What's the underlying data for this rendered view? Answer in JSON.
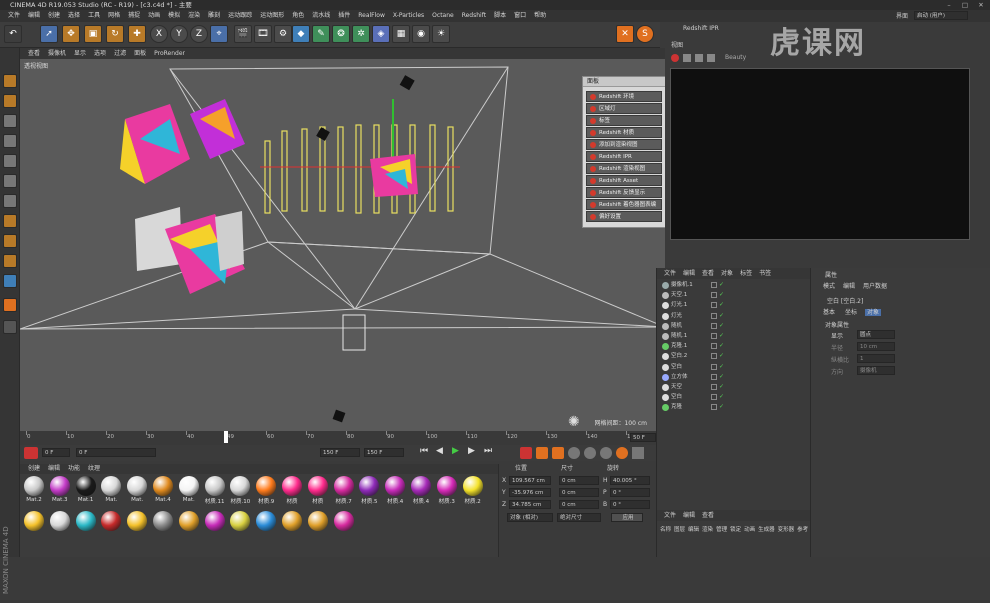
{
  "window": {
    "title": "CINEMA 4D R19.053 Studio (RC - R19) - [c3.c4d *] - 主要",
    "layout_label": "界面",
    "layout_value": "启动 (用户)"
  },
  "menu": [
    "文件",
    "编辑",
    "创建",
    "选择",
    "工具",
    "网格",
    "捕捉",
    "动画",
    "模拟",
    "渲染",
    "雕刻",
    "运动跟踪",
    "运动图形",
    "角色",
    "流水线",
    "插件",
    "RealFlow",
    "X-Particles",
    "Octane",
    "Redshift",
    "脚本",
    "窗口",
    "帮助"
  ],
  "toolbar": {
    "axis_labels": [
      "X",
      "Y",
      "Z"
    ],
    "redshift_icon": "S"
  },
  "viewport": {
    "tabs": [
      "查看",
      "摄像机",
      "显示",
      "选项",
      "过滤",
      "面板",
      "ProRender"
    ],
    "label": "透视视图",
    "grid_spacing": "网格间距：100 cm"
  },
  "timeline": {
    "ticks": [
      "0",
      "10",
      "20",
      "30",
      "40",
      "49",
      "60",
      "70",
      "80",
      "90",
      "100",
      "110",
      "120",
      "130",
      "140",
      "150"
    ],
    "current_frame": "49",
    "end_label": "50 F"
  },
  "transport": {
    "start": "0 F",
    "field_start": "0 F",
    "field_end": "150 F",
    "field_end2": "150 F"
  },
  "redshift_menu": {
    "header": "面板",
    "items": [
      "Redshift 环境",
      "区域灯",
      "标签",
      "Redshift 材质",
      "添加到渲染视图",
      "Redshift IPR",
      "Redshift 渲染视图",
      "Redshift Asset Manager",
      "Redshift 反馈显示",
      "Redshift 着色器图表编辑器",
      "偏好设置"
    ]
  },
  "ipr": {
    "title": "Redshift IPR",
    "subtitle": "视图",
    "dropdown": "Beauty"
  },
  "watermark": "虎课网",
  "object_manager": {
    "tabs": [
      "文件",
      "编辑",
      "查看",
      "对象",
      "标签",
      "书签"
    ],
    "rows": [
      "摄像机.1",
      "天空.1",
      "灯光.1",
      "灯光",
      "随机",
      "随机.1",
      "克隆.1",
      "空白.2",
      "空白",
      "立方体",
      "天空",
      "空白",
      "克隆"
    ],
    "bottom_tabs": [
      "文件",
      "编辑",
      "查看"
    ],
    "footer": [
      "名称",
      "图层",
      "编辑",
      "渲染",
      "管理",
      "锁定",
      "动画",
      "生成器",
      "变形器",
      "参考"
    ]
  },
  "attributes": {
    "header": "属性",
    "tabs": [
      "模式",
      "编辑",
      "用户数据"
    ],
    "object_name": "空白 [空白.2]",
    "subtabs": [
      "基本",
      "坐标",
      "对象"
    ],
    "section": "对象属性",
    "display_label": "显示",
    "display_value": "圆点",
    "radius_label": "半径",
    "radius_value": "10 cm",
    "aspect_label": "纵横比",
    "aspect_value": "1",
    "orientation_label": "方向",
    "orientation_value": "摄像机"
  },
  "material_tabs": [
    "创建",
    "编辑",
    "功能",
    "纹理"
  ],
  "materials_row1": [
    "Mat.2",
    "Mat.3",
    "Mat.1",
    "Mat.",
    "Mat.",
    "Mat.4",
    "Mat.",
    "材质.11",
    "材质.10",
    "材质.9",
    "材质",
    "材质",
    "材质.7",
    "材质.5",
    "材质.4",
    "材质.4",
    "材质.3",
    "材质.2"
  ],
  "materials_row1_colors": [
    "#c9c9c9",
    "#c33bc7",
    "#1a1a1a",
    "#d8d8d8",
    "#d8d8d8",
    "#e08a1e",
    "#f4f4f4",
    "#c9c9c9",
    "#d8d8d8",
    "#ff7b1c",
    "#ff2a8c",
    "#ff2a8c",
    "#d62a9f",
    "#8e2ab8",
    "#c62ab8",
    "#a62ab8",
    "#d62ab8",
    "#f4e22a"
  ],
  "materials_row2_colors": [
    "#f4c12a",
    "#d8d8d8",
    "#2ab8c6",
    "#c62a2a",
    "#f4c12a",
    "#8c8c8c",
    "#e0a02a",
    "#c62ab8",
    "#d8d040",
    "#2a8cd8",
    "#e0a02a",
    "#e0a02a",
    "#d62a9f"
  ],
  "coordinates": {
    "headers": [
      "位置",
      "尺寸",
      "旋转"
    ],
    "rows": [
      {
        "axis": "X",
        "pos": "109.567 cm",
        "size": "0 cm",
        "rot_axis": "H",
        "rot": "40.005 °"
      },
      {
        "axis": "Y",
        "pos": "-35.976 cm",
        "size": "0 cm",
        "rot_axis": "P",
        "rot": "0 °"
      },
      {
        "axis": "Z",
        "pos": "34.785 cm",
        "size": "0 cm",
        "rot_axis": "B",
        "rot": "0 °"
      }
    ],
    "mode1": "对象 (相对)",
    "mode2": "绝对尺寸",
    "apply": "应用"
  },
  "sidebar_brand": "MAXON CINEMA 4D"
}
